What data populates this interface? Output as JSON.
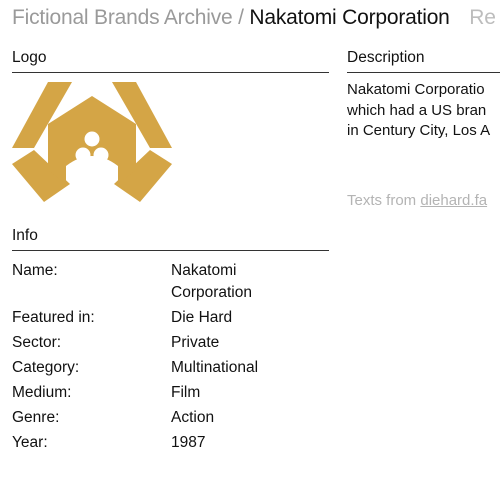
{
  "header": {
    "breadcrumb": "Fictional Brands Archive",
    "separator": "/",
    "current": "Nakatomi Corporation",
    "next_partial": "Re"
  },
  "logo_section": {
    "title": "Logo",
    "accent_color": "#d4a546",
    "icon": "nakatomi-logo-icon"
  },
  "description_section": {
    "title": "Description",
    "lines": [
      "Nakatomi Corporatio",
      "which had a US bran",
      "in Century City, Los A"
    ],
    "source_prefix": "Texts from",
    "source_link": "diehard.fa"
  },
  "info_section": {
    "title": "Info",
    "rows": [
      {
        "label": "Name:",
        "value": "Nakatomi Corporation"
      },
      {
        "label": "Featured in:",
        "value": "Die Hard"
      },
      {
        "label": "Sector:",
        "value": "Private"
      },
      {
        "label": "Category:",
        "value": "Multinational"
      },
      {
        "label": "Medium:",
        "value": "Film"
      },
      {
        "label": "Genre:",
        "value": "Action"
      },
      {
        "label": "Year:",
        "value": "1987"
      }
    ]
  }
}
